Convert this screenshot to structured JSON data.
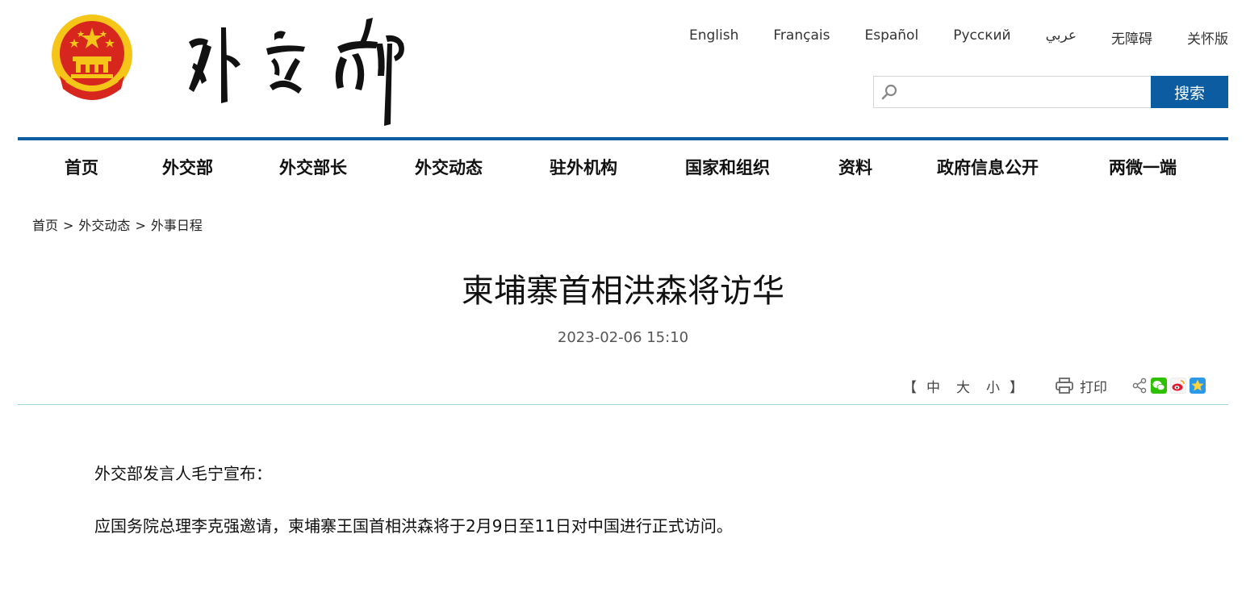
{
  "site": {
    "logo_text": "外交部",
    "languages": [
      "English",
      "Français",
      "Español",
      "Русский",
      "عربي",
      "无障碍",
      "关怀版"
    ],
    "search": {
      "placeholder": "",
      "button_label": "搜索"
    }
  },
  "nav": {
    "items": [
      "首页",
      "外交部",
      "外交部长",
      "外交动态",
      "驻外机构",
      "国家和组织",
      "资料",
      "政府信息公开",
      "两微一端"
    ]
  },
  "breadcrumb": {
    "items": [
      "首页",
      "外交动态",
      "外事日程"
    ],
    "separator": ">"
  },
  "article": {
    "title": "柬埔寨首相洪森将访华",
    "date": "2023-02-06 15:10",
    "tools": {
      "bracket_open": "【",
      "size_medium": "中",
      "size_large": "大",
      "size_small": "小",
      "bracket_close": "】",
      "print_label": "打印"
    },
    "paragraphs": [
      "外交部发言人毛宁宣布：",
      "应国务院总理李克强邀请，柬埔寨王国首相洪森将于2月9日至11日对中国进行正式访问。"
    ]
  },
  "colors": {
    "brand_blue": "#0b5ca0",
    "divider": "#9fd7d3",
    "emblem_red": "#d7261e",
    "emblem_gold": "#f5c518"
  },
  "icons": [
    "national-emblem",
    "search-icon",
    "print-icon",
    "share-icon",
    "wechat-icon",
    "weibo-icon",
    "qzone-icon"
  ]
}
